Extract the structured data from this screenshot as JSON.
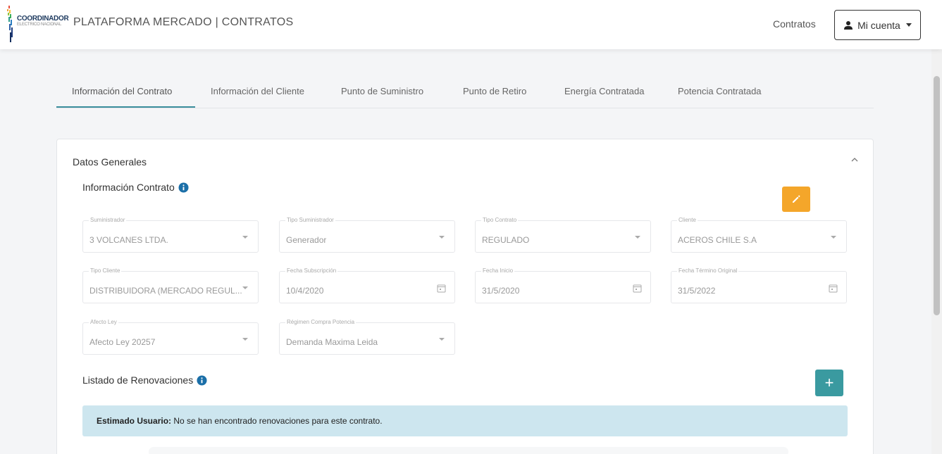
{
  "header": {
    "logo_text": "COORDINADOR",
    "logo_sub": "ELECTRICO NACIONAL",
    "title": "PLATAFORMA MERCADO | CONTRATOS",
    "nav_link": "Contratos",
    "account_label": "Mi cuenta",
    "icons": {
      "user": "user-icon",
      "caret": "caret-down-icon"
    }
  },
  "tabs": [
    {
      "label": "Información del Contrato",
      "active": true
    },
    {
      "label": "Información del Cliente",
      "active": false
    },
    {
      "label": "Punto de Suministro",
      "active": false
    },
    {
      "label": "Punto de Retiro",
      "active": false
    },
    {
      "label": "Energía Contratada",
      "active": false
    },
    {
      "label": "Potencia Contratada",
      "active": false
    }
  ],
  "card": {
    "title": "Datos Generales",
    "section_info": "Información Contrato",
    "section_renovaciones": "Listado de Renovaciones",
    "fields": [
      {
        "label": "Suministrador",
        "value": "3 VOLCANES LTDA.",
        "kind": "select"
      },
      {
        "label": "Tipo Suministrador",
        "value": "Generador",
        "kind": "select"
      },
      {
        "label": "Tipo Contrato",
        "value": "REGULADO",
        "kind": "select"
      },
      {
        "label": "Cliente",
        "value": "ACEROS CHILE S.A",
        "kind": "select"
      },
      {
        "label": "Tipo Cliente",
        "value": "DISTRIBUIDORA (MERCADO REGUL...",
        "kind": "select"
      },
      {
        "label": "Fecha Subscripción",
        "value": "10/4/2020",
        "kind": "date"
      },
      {
        "label": "Fecha Inicio",
        "value": "31/5/2020",
        "kind": "date"
      },
      {
        "label": "Fecha Término Original",
        "value": "31/5/2022",
        "kind": "date"
      },
      {
        "label": "Afecto Ley",
        "value": "Afecto Ley 20257",
        "kind": "select"
      },
      {
        "label": "Régimen Compra Potencia",
        "value": "Demanda Maxima Leida",
        "kind": "select"
      }
    ],
    "alert": {
      "strong": "Estimado Usuario:",
      "text": " No se han encontrado renovaciones para este contrato."
    },
    "add_button": "+"
  },
  "colors": {
    "accent": "#3a8d9c",
    "edit_button": "#f4a62a",
    "add_button": "#3a9aa0",
    "alert_bg": "#cde6ef",
    "info_icon": "#1b6fa8"
  }
}
